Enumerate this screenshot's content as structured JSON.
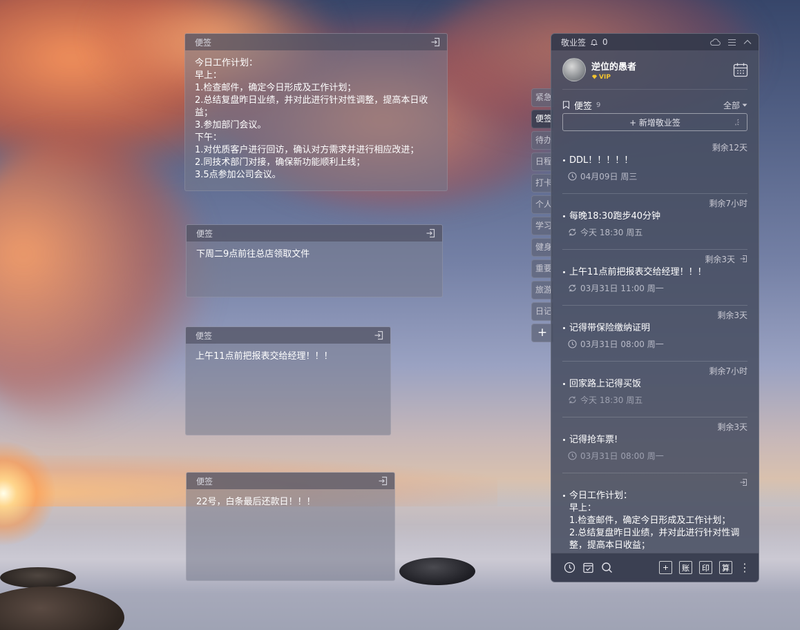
{
  "notes": [
    {
      "header": "便签",
      "body": "今日工作计划：\n早上：\n1.检查邮件，确定今日形成及工作计划；\n2.总结复盘昨日业绩，并对此进行针对性调整，提高本日收益；\n3.参加部门会议。\n下午：\n1.对优质客户进行回访，确认对方需求并进行相应改进；\n2.同技术部门对接，确保新功能顺利上线；\n3.5点参加公司会议。"
    },
    {
      "header": "便签",
      "body": "下周二9点前往总店领取文件"
    },
    {
      "header": "便签",
      "body": "上午11点前把报表交给经理！！！"
    },
    {
      "header": "便签",
      "body": "22号，白条最后还款日！！！"
    }
  ],
  "side_tabs": [
    {
      "label": "紧急",
      "active": false
    },
    {
      "label": "便签",
      "active": true
    },
    {
      "label": "待办",
      "active": false
    },
    {
      "label": "日程",
      "active": false
    },
    {
      "label": "打卡",
      "active": false
    },
    {
      "label": "个人",
      "active": false
    },
    {
      "label": "学习",
      "active": false
    },
    {
      "label": "健身",
      "active": false
    },
    {
      "label": "重要",
      "active": false
    },
    {
      "label": "旅游",
      "active": false
    },
    {
      "label": "日记",
      "active": false
    }
  ],
  "side_tab_add": "+",
  "panel": {
    "app_name": "敬业签",
    "bell_count": "0",
    "username": "逆位的愚者",
    "vip_label": "VIP",
    "section_title": "便签",
    "section_count": "9",
    "filter_label": "全部",
    "new_button_label": "+ 新增敬业签",
    "items": [
      {
        "remain": "剩余12天",
        "title": "DDL！！！！！",
        "time": "04月09日 周三",
        "icon": "clock-icon",
        "dim": false,
        "has_exit": false
      },
      {
        "remain": "剩余7小时",
        "title": "每晚18:30跑步40分钟",
        "time": "今天 18:30 周五",
        "icon": "repeat-icon",
        "dim": false,
        "has_exit": false
      },
      {
        "remain": "剩余3天",
        "title": "上午11点前把报表交给经理！！！",
        "time": "03月31日 11:00 周一",
        "icon": "repeat-icon",
        "dim": false,
        "has_exit": true
      },
      {
        "remain": "剩余3天",
        "title": "记得带保险缴纳证明",
        "time": "03月31日 08:00 周一",
        "icon": "clock-icon",
        "dim": false,
        "has_exit": false
      },
      {
        "remain": "剩余7小时",
        "title": "回家路上记得买饭",
        "time": "今天 18:30 周五",
        "icon": "repeat-icon",
        "dim": true,
        "has_exit": false
      },
      {
        "remain": "剩余3天",
        "title": "记得抢车票!",
        "time": "03月31日 08:00 周一",
        "icon": "clock-icon",
        "dim": true,
        "has_exit": false
      }
    ],
    "last_item": {
      "title": "今日工作计划：\n早上：\n1.检查邮件，确定今日形成及工作计划；\n2.总结复盘昨日业绩，并对此进行针对性调\n整，提高本日收益；"
    },
    "footer_buttons": [
      "+",
      "账",
      "印",
      "算"
    ]
  },
  "colors": {
    "panel_bg": "#484e62",
    "vip_gold": "#f4c430",
    "note_bg": "#767a8c"
  }
}
